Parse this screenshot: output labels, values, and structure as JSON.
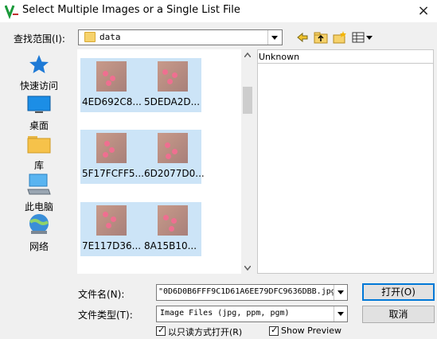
{
  "window": {
    "title": "Select Multiple Images or a Single List File",
    "close_glyph": "×"
  },
  "look_in": {
    "label": "查找范围(I):",
    "value": "data"
  },
  "places": [
    {
      "label": "快速访问",
      "icon": "quick-access-star-icon"
    },
    {
      "label": "桌面",
      "icon": "desktop-icon"
    },
    {
      "label": "库",
      "icon": "libraries-folder-icon"
    },
    {
      "label": "此电脑",
      "icon": "this-pc-icon"
    },
    {
      "label": "网络",
      "icon": "network-icon"
    }
  ],
  "files": [
    "4ED692C8...",
    "5DEDA2D...",
    "5F17FCFF5...",
    "6D2077D0...",
    "7E117D36...",
    "8A15B10..."
  ],
  "preview": {
    "label": "Unknown"
  },
  "file_name": {
    "label": "文件名(N):",
    "value": "\"0D6D0B6FFF9C1D61A6EE79DFC9636DBB.jpg\""
  },
  "file_type": {
    "label": "文件类型(T):",
    "value": "Image Files (jpg, ppm, pgm)"
  },
  "buttons": {
    "open": "打开(O)",
    "cancel": "取消"
  },
  "checkboxes": {
    "read_only": {
      "label": "以只读方式打开(R)",
      "checked": true
    },
    "show_preview": {
      "label": "Show Preview",
      "checked": true
    }
  },
  "colors": {
    "selection": "#cce4f7",
    "accent": "#0078d7"
  }
}
